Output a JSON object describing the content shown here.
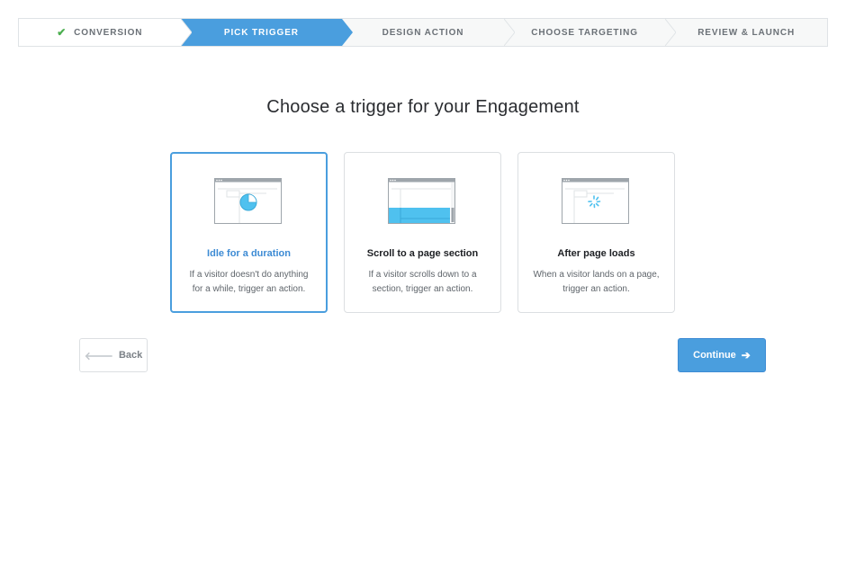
{
  "stepper": {
    "steps": [
      {
        "label": "CONVERSION",
        "state": "done"
      },
      {
        "label": "PICK TRIGGER",
        "state": "active"
      },
      {
        "label": "DESIGN ACTION",
        "state": "upcoming"
      },
      {
        "label": "CHOOSE TARGETING",
        "state": "upcoming"
      },
      {
        "label": "REVIEW & LAUNCH",
        "state": "upcoming"
      }
    ],
    "done_icon": "checkmark-icon"
  },
  "heading": "Choose a trigger for your Engagement",
  "cards": [
    {
      "title": "Idle for a duration",
      "description": "If a visitor doesn't do anything for a while, trigger an action.",
      "icon": "idle-timer-icon",
      "selected": true
    },
    {
      "title": "Scroll to a page section",
      "description": "If a visitor scrolls down to a section, trigger an action.",
      "icon": "scroll-page-icon",
      "selected": false
    },
    {
      "title": "After page loads",
      "description": "When a visitor lands on a page, trigger an action.",
      "icon": "page-loading-icon",
      "selected": false
    }
  ],
  "buttons": {
    "back_label": "Back",
    "continue_label": "Continue"
  },
  "colors": {
    "accent": "#4a9ede",
    "done_check": "#4caf50"
  }
}
